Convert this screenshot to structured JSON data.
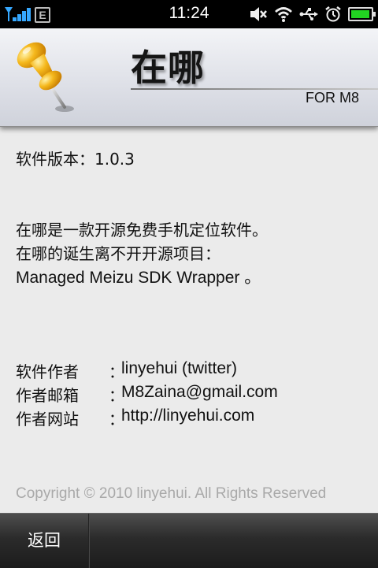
{
  "status_bar": {
    "time": "11:24",
    "network_type": "E",
    "icons": [
      "signal-icon",
      "mute-icon",
      "wifi-icon",
      "usb-icon",
      "alarm-icon",
      "battery-icon"
    ],
    "battery_level": 0.95,
    "colors": {
      "signal": "#36a8ff",
      "battery": "#22d422"
    }
  },
  "header": {
    "title": "在哪",
    "subtitle": "FOR M8",
    "logo_icon": "pushpin-icon"
  },
  "content": {
    "version_line": "软件版本：1.0.3",
    "description": [
      "在哪是一款开源免费手机定位软件。",
      "在哪的诞生离不开开源项目：",
      "Managed Meizu SDK Wrapper 。"
    ],
    "info_rows": [
      {
        "label": "软件作者",
        "colon": "：",
        "value": "linyehui (twitter)"
      },
      {
        "label": "作者邮箱",
        "colon": "：",
        "value": "M8Zaina@gmail.com"
      },
      {
        "label": "作者网站",
        "colon": "：",
        "value": "http://linyehui.com"
      }
    ],
    "copyright": "Copyright © 2010 linyehui. All Rights Reserved"
  },
  "bottom_bar": {
    "back_label": "返回"
  }
}
